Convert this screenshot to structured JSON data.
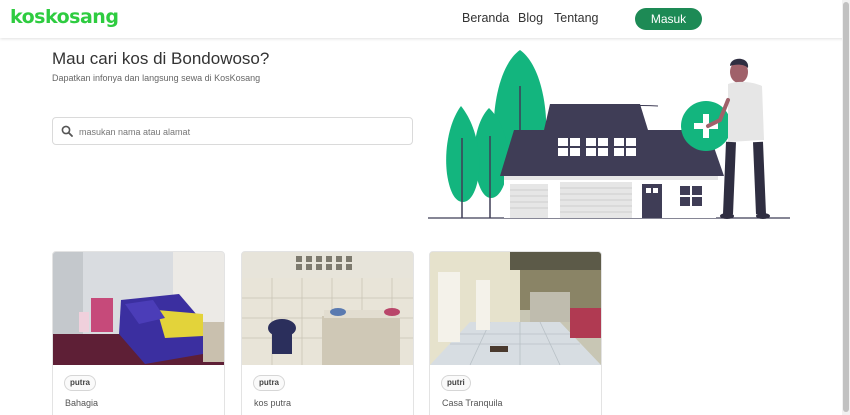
{
  "brand": {
    "logo_text": "koskosang",
    "color": "#2ecc40"
  },
  "nav": {
    "links": [
      "Beranda",
      "Blog",
      "Tentang"
    ],
    "login_label": "Masuk",
    "login_color": "#1d8a55"
  },
  "hero": {
    "title": "Mau cari kos di Bondowoso?",
    "subtitle": "Dapatkan infonya dan langsung sewa di KosKosang",
    "search_placeholder": "masukan nama atau alamat",
    "search_value": ""
  },
  "listings": [
    {
      "tag": "putra",
      "name": "Bahagia"
    },
    {
      "tag": "putra",
      "name": "kos putra"
    },
    {
      "tag": "putri",
      "name": "Casa Tranquila"
    }
  ],
  "colors": {
    "tree": "#13b57e",
    "roof": "#3f3d56",
    "accent": "#00bf8a"
  }
}
